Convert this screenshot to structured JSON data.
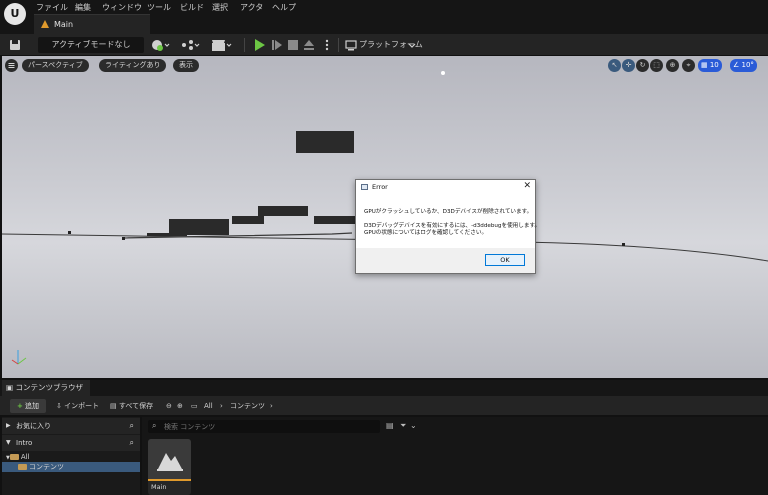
{
  "menu": {
    "logo": "U",
    "items": [
      "ファイル",
      "編集",
      "ウィンドウ",
      "ツール",
      "ビルド",
      "選択",
      "アクタ",
      "ヘルプ"
    ]
  },
  "level_tab": {
    "label": "Main"
  },
  "toolbar": {
    "mode_select": "アクティブモードなし",
    "platform": "プラットフォーム"
  },
  "viewport": {
    "perspective": "パースペクティブ",
    "lighting": "ライティングあり",
    "show": "表示",
    "grid_snap": "10",
    "angle_snap": "10°"
  },
  "dialog": {
    "title": "Error",
    "close": "✕",
    "line1": "GPUがクラッシュしているか、D3Dデバイスが削除されています。",
    "line2": "D3Dデバッグデバイスを有効にするには、-d3ddebugを使用します。",
    "line3": "GPUの状態についてはログを確認してください。",
    "ok": "OK"
  },
  "content_browser": {
    "tab": "コンテンツブラウザ",
    "tab_close": "×",
    "add": "追加",
    "import": "インポート",
    "save_all": "すべて保存",
    "crumb_all": "All",
    "crumb_content": "コンテンツ",
    "favorites": "お気に入り",
    "project": "Intro",
    "tree_all": "All",
    "tree_content": "コンテンツ",
    "search_placeholder": "検索 コンテンツ",
    "asset_name": "Main"
  },
  "colors": {
    "accent_blue": "#2a5bd7",
    "play_green": "#6cc644",
    "asset_orange": "#e09a2c"
  }
}
